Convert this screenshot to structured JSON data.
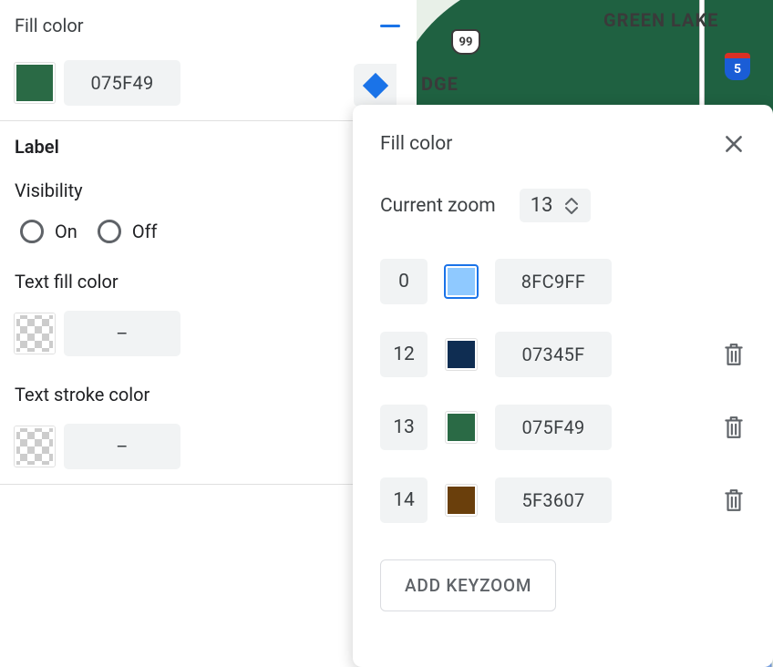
{
  "left": {
    "fill_section_title": "Fill color",
    "fill_swatch_color": "#2a6a45",
    "fill_hex": "075F49",
    "label_heading": "Label",
    "visibility_heading": "Visibility",
    "visibility_on": "On",
    "visibility_off": "Off",
    "text_fill_heading": "Text fill color",
    "text_fill_value": "–",
    "text_stroke_heading": "Text stroke color",
    "text_stroke_value": "–"
  },
  "map": {
    "greenlake_label": "GREEN LAKE",
    "dge_label": "DGE",
    "hwy99": "99",
    "i5": "5"
  },
  "popup": {
    "title": "Fill color",
    "current_zoom_label": "Current zoom",
    "current_zoom_value": "13",
    "keyzooms": [
      {
        "zoom": "0",
        "color": "#8fc9ff",
        "hex": "8FC9FF",
        "selected": true,
        "deletable": false
      },
      {
        "zoom": "12",
        "color": "#0f2d52",
        "hex": "07345F",
        "selected": false,
        "deletable": true
      },
      {
        "zoom": "13",
        "color": "#2a6a45",
        "hex": "075F49",
        "selected": false,
        "deletable": true
      },
      {
        "zoom": "14",
        "color": "#6a3f0c",
        "hex": "5F3607",
        "selected": false,
        "deletable": true
      }
    ],
    "add_button": "ADD KEYZOOM"
  }
}
